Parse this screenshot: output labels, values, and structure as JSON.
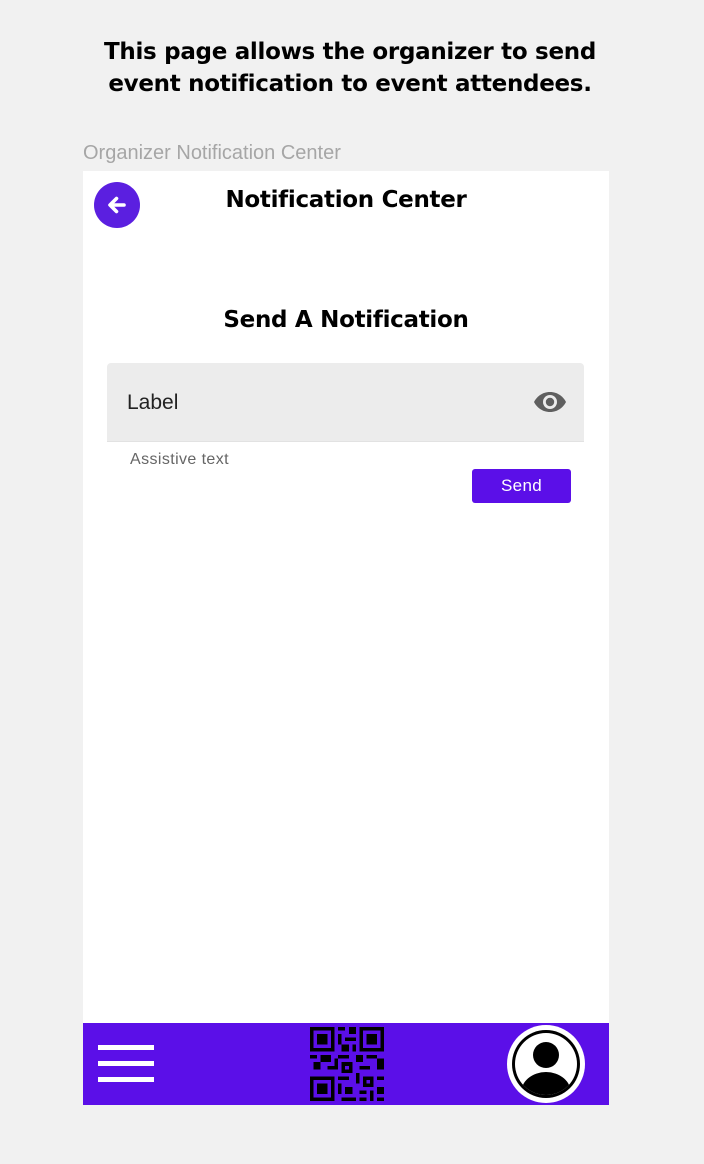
{
  "description": {
    "line1": "This page allows the organizer to send",
    "line2": "event notification to event attendees."
  },
  "frame_label": "Organizer Notification Center",
  "header": {
    "title": "Notification Center",
    "back_icon": "arrow-left-icon"
  },
  "main": {
    "section_title": "Send A Notification",
    "text_field": {
      "label": "Label",
      "trailing_icon": "eye-icon",
      "assistive_text": "Assistive text"
    },
    "send_label": "Send"
  },
  "bottom_nav": {
    "menu_icon": "hamburger-menu-icon",
    "center_icon": "qr-code-icon",
    "right_icon": "user-avatar-icon"
  },
  "colors": {
    "accent": "#5b0fe8",
    "back_button": "#5b1fe0",
    "page_background": "#f1f1f1",
    "field_background": "#ececec",
    "frame_label": "#a6a6a6"
  }
}
